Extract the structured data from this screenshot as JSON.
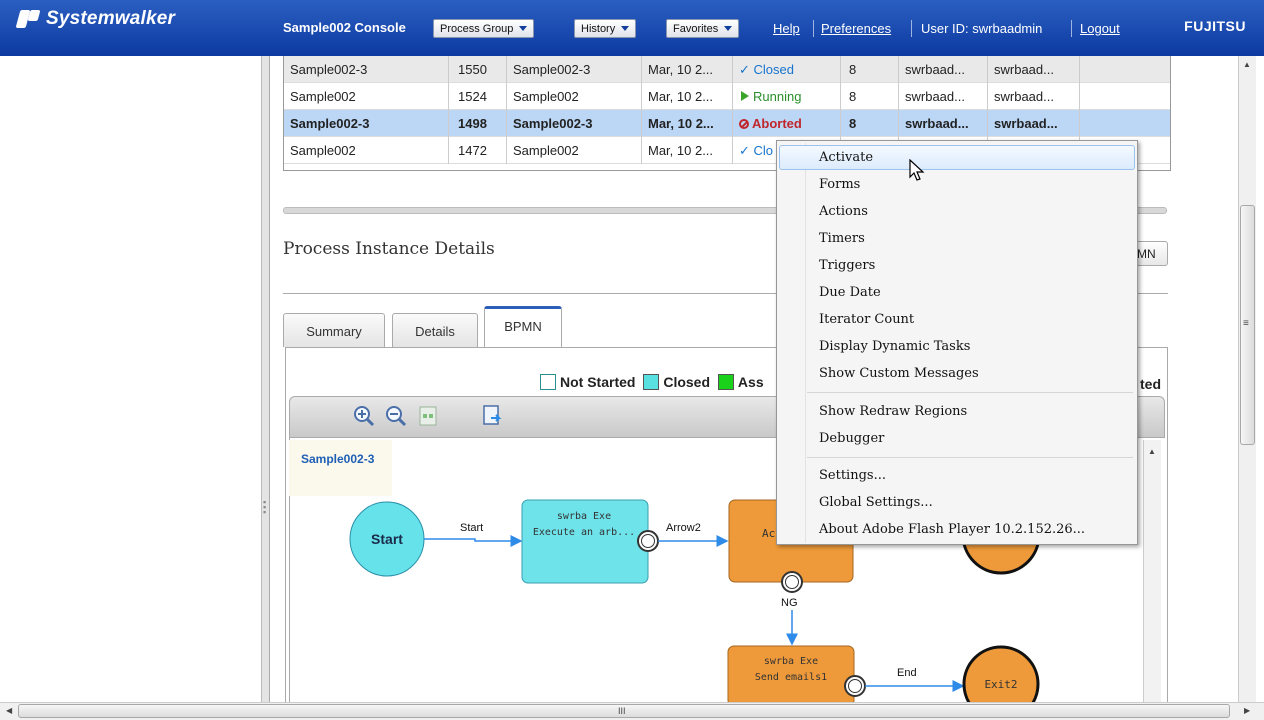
{
  "header": {
    "brand": "Systemwalker",
    "console_title": "Sample002 Console",
    "menus": [
      "Process Group",
      "History",
      "Favorites"
    ],
    "help": "Help",
    "preferences": "Preferences",
    "user_id": "User ID: swrbaadmin",
    "logout": "Logout",
    "vendor": "FUJITSU"
  },
  "table": {
    "rows": [
      {
        "name": "Sample002-3",
        "id": "1550",
        "pd": "Sample002-3",
        "date": "Mar, 10 2...",
        "status": "Closed",
        "prio": "8",
        "owner": "swrbaad...",
        "initiator": "swrbaad..."
      },
      {
        "name": "Sample002",
        "id": "1524",
        "pd": "Sample002",
        "date": "Mar, 10 2...",
        "status": "Running",
        "prio": "8",
        "owner": "swrbaad...",
        "initiator": "swrbaad..."
      },
      {
        "name": "Sample002-3",
        "id": "1498",
        "pd": "Sample002-3",
        "date": "Mar, 10 2...",
        "status": "Aborted",
        "prio": "8",
        "owner": "swrbaad...",
        "initiator": "swrbaad..."
      },
      {
        "name": "Sample002",
        "id": "1472",
        "pd": "Sample002",
        "date": "Mar, 10 2...",
        "status": "Clo",
        "prio": "",
        "owner": "",
        "initiator": ""
      }
    ]
  },
  "details": {
    "title": "Process Instance Details",
    "bpmn_button_part": "MN",
    "tabs": [
      "Summary",
      "Details",
      "BPMN"
    ],
    "active_tab": "BPMN",
    "legend": [
      "Not Started",
      "Closed",
      "Ass"
    ],
    "legend_tail": "ted",
    "legend_colors": {
      "not_started": "#ffffff",
      "closed": "#59e0e0",
      "assigned": "#19d219"
    }
  },
  "diagram": {
    "process_name": "Sample002-3",
    "start_label": "Start",
    "edges": {
      "start": "Start",
      "arrow2": "Arrow2",
      "ng": "NG",
      "end": "End"
    },
    "task1": {
      "line1": "swrba Exe",
      "line2": "Execute an arb..."
    },
    "task2": {
      "line1": "Ac"
    },
    "task3": {
      "line1": "swrba Exe",
      "line2": "Send emails1"
    },
    "exit2": "Exit2",
    "colors": {
      "start": "#66e2ea",
      "task_closed": "#6fe3ea",
      "task_active": "#ee9a3a",
      "edge": "#2f8be8"
    }
  },
  "context_menu": {
    "group1": [
      "Activate",
      "Forms",
      "Actions",
      "Timers",
      "Triggers",
      "Due Date",
      "Iterator Count",
      "Display Dynamic Tasks",
      "Show Custom Messages"
    ],
    "group2": [
      "Show Redraw Regions",
      "Debugger"
    ],
    "group3": [
      "Settings...",
      "Global Settings...",
      "About Adobe Flash Player 10.2.152.26..."
    ],
    "highlighted": "Activate"
  },
  "scroll": {
    "h_label": "III",
    "v_label": "≡"
  }
}
